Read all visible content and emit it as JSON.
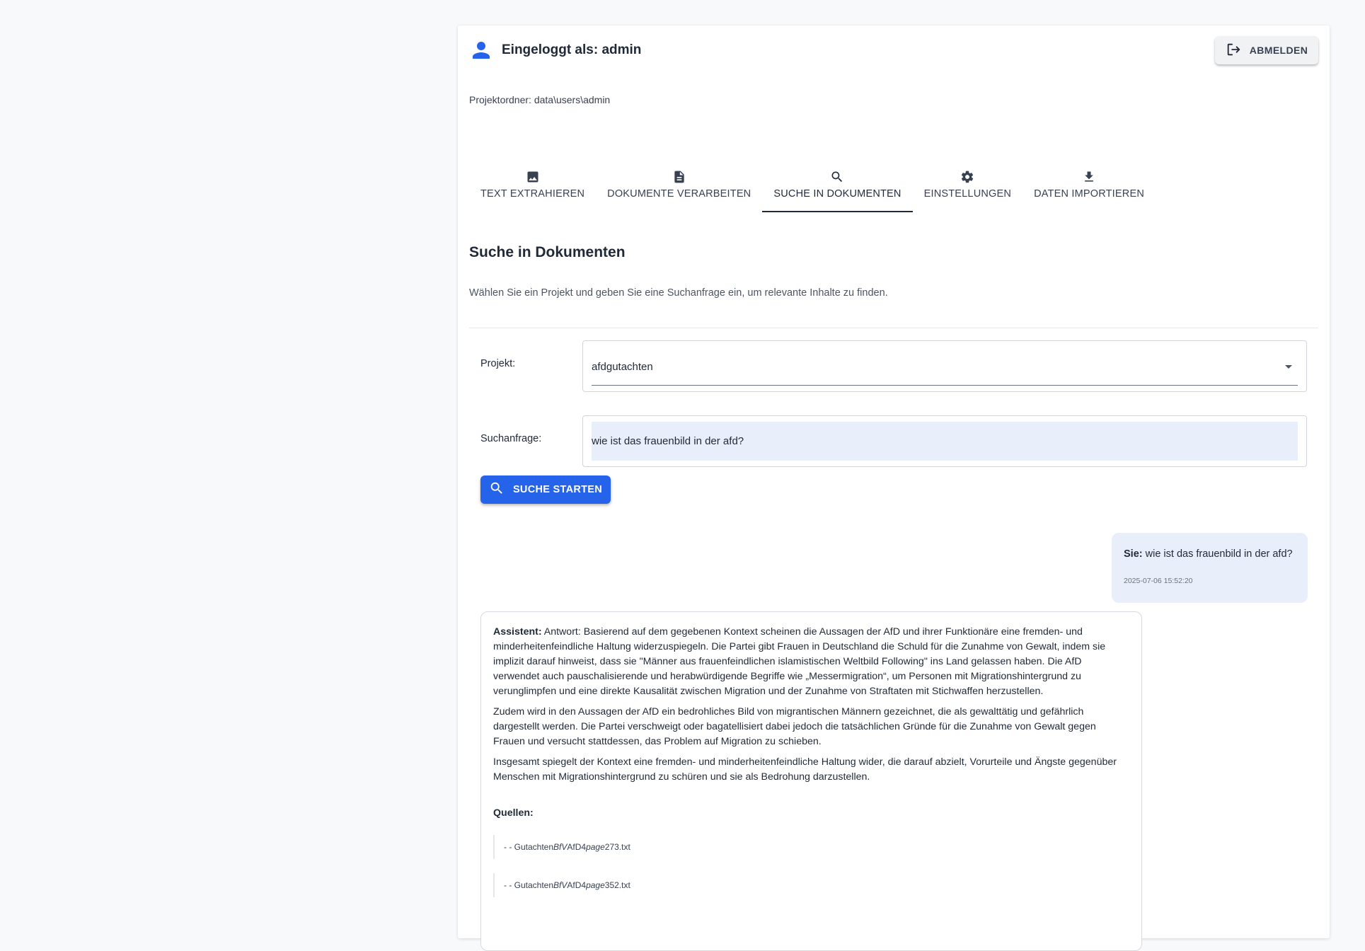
{
  "header": {
    "user_label": "Eingeloggt als: admin",
    "logout_label": "ABMELDEN",
    "project_folder": "Projektordner: data\\users\\admin"
  },
  "tabs": [
    {
      "label": "TEXT EXTRAHIEREN",
      "icon": "image-icon",
      "active": false
    },
    {
      "label": "DOKUMENTE VERARBEITEN",
      "icon": "document-icon",
      "active": false
    },
    {
      "label": "SUCHE IN DOKUMENTEN",
      "icon": "search-icon",
      "active": true
    },
    {
      "label": "EINSTELLUNGEN",
      "icon": "gear-icon",
      "active": false
    },
    {
      "label": "DATEN IMPORTIEREN",
      "icon": "download-icon",
      "active": false
    }
  ],
  "search": {
    "title": "Suche in Dokumenten",
    "description": "Wählen Sie ein Projekt und geben Sie eine Suchanfrage ein, um relevante Inhalte zu finden.",
    "project_label": "Projekt:",
    "project_value": "afdgutachten",
    "query_label": "Suchanfrage:",
    "query_value": "wie ist das frauenbild in der afd?",
    "button_label": "SUCHE STARTEN"
  },
  "chat": {
    "user": {
      "prefix": "Sie:",
      "text": "wie ist das frauenbild in der afd?",
      "time": "2025-07-06 15:52:20"
    },
    "assistant": {
      "prefix": "Assistent:",
      "paragraphs": [
        "Antwort: Basierend auf dem gegebenen Kontext scheinen die Aussagen der AfD und ihrer Funktionäre eine fremden- und minderheitenfeindliche Haltung widerzuspiegeln. Die Partei gibt Frauen in Deutschland die Schuld für die Zunahme von Gewalt, indem sie implizit darauf hinweist, dass sie \"Männer aus frauenfeindlichen islamistischen Weltbild Following\" ins Land gelassen haben. Die AfD verwendet auch pauschalisierende und herabwürdigende Begriffe wie „Messermigration“, um Personen mit Migrationshintergrund zu verunglimpfen und eine direkte Kausalität zwischen Migration und der Zunahme von Straftaten mit Stichwaffen herzustellen.",
        "Zudem wird in den Aussagen der AfD ein bedrohliches Bild von migrantischen Männern gezeichnet, die als gewalttätig und gefährlich dargestellt werden. Die Partei verschweigt oder bagatellisiert dabei jedoch die tatsächlichen Gründe für die Zunahme von Gewalt gegen Frauen und versucht stattdessen, das Problem auf Migration zu schieben.",
        "Insgesamt spiegelt der Kontext eine fremden- und minderheitenfeindliche Haltung wider, die darauf abzielt, Vorurteile und Ängste gegenüber Menschen mit Migrationshintergrund zu schüren und sie als Bedrohung darzustellen."
      ],
      "sources_title": "Quellen:",
      "sources": [
        {
          "prefix": "- - Gutachten",
          "italic1": "BfV",
          "mid": "AfD4",
          "italic2": "page",
          "suffix": "273.txt"
        },
        {
          "prefix": "- - Gutachten",
          "italic1": "BfV",
          "mid": "AfD4",
          "italic2": "page",
          "suffix": "352.txt"
        }
      ]
    }
  },
  "colors": {
    "accent": "#2563eb",
    "user_bubble": "#e8effa",
    "page_bg": "#f8f9fb"
  }
}
